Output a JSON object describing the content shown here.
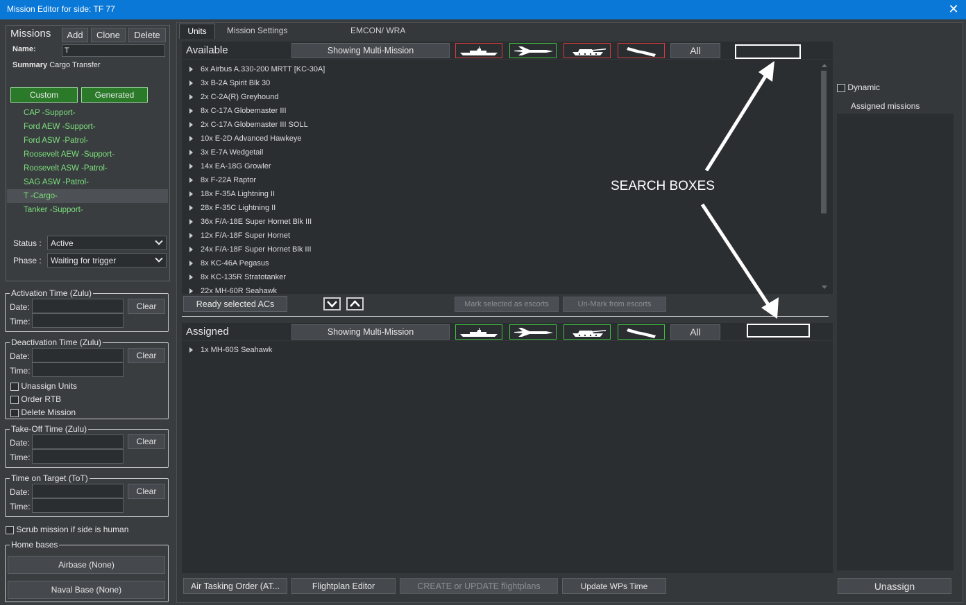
{
  "window": {
    "title": "Mission Editor for side: TF 77",
    "close_symbol": "✕"
  },
  "missions": {
    "header": "Missions",
    "add_label": "Add",
    "clone_label": "Clone",
    "delete_label": "Delete",
    "name_label": "Name:",
    "name_value": "T",
    "summary_label": "Summary",
    "summary_value": "Cargo Transfer",
    "custom_label": "Custom",
    "generated_label": "Generated",
    "items": [
      "CAP -Support-",
      "Ford AEW -Support-",
      "Ford ASW  -Patrol-",
      "Roosevelt AEW -Support-",
      "Roosevelt ASW -Patrol-",
      "SAG ASW  -Patrol-",
      "T -Cargo-",
      "Tanker -Support-"
    ],
    "selected_index": 6,
    "status_label": "Status :",
    "status_value": "Active",
    "phase_label": "Phase :",
    "phase_value": "Waiting for trigger"
  },
  "times": {
    "activation_title": "Activation Time (Zulu)",
    "deactivation_title": "Deactivation Time (Zulu)",
    "takeoff_title": "Take-Off Time (Zulu)",
    "tot_title": "Time on Target (ToT)",
    "date_label": "Date:",
    "time_label": "Time:",
    "clear_label": "Clear",
    "unassign_units": "Unassign Units",
    "order_rtb": "Order RTB",
    "delete_mission": "Delete Mission"
  },
  "scrub_label": "Scrub mission if side is human",
  "home_bases": {
    "title": "Home bases",
    "airbase": "Airbase (None)",
    "naval_base": "Naval Base (None)"
  },
  "tabs": {
    "units": "Units",
    "settings": "Mission Settings",
    "emcon": "EMCON/ WRA"
  },
  "available": {
    "title": "Available",
    "showing": "Showing Multi-Mission",
    "all_label": "All",
    "units": [
      "6x Airbus A.330-200 MRTT [KC-30A]",
      "3x B-2A Spirit Blk 30",
      "2x C-2A(R) Greyhound",
      "8x C-17A Globemaster III",
      "2x C-17A Globemaster III SOLL",
      "10x E-2D Advanced Hawkeye",
      "3x E-7A Wedgetail",
      "14x EA-18G Growler",
      "8x F-22A Raptor",
      "18x F-35A Lightning II",
      "28x F-35C Lightning II",
      "36x F/A-18E Super Hornet Blk III",
      "12x F/A-18F Super Hornet",
      "24x F/A-18F Super Hornet Blk III",
      "8x KC-46A Pegasus",
      "8x KC-135R Stratotanker",
      "22x MH-60R Seahawk"
    ]
  },
  "middle": {
    "ready_label": "Ready selected ACs",
    "mark_label": "Mark selected as escorts",
    "unmark_label": "Un-Mark from escorts"
  },
  "assigned": {
    "title": "Assigned",
    "showing": "Showing Multi-Mission",
    "all_label": "All",
    "units": [
      "1x MH-60S Seahawk"
    ]
  },
  "right_panel": {
    "dynamic_label": "Dynamic",
    "assigned_missions": "Assigned missions",
    "unassign_label": "Unassign"
  },
  "bottom": {
    "ato_label": "Air Tasking Order (AT...",
    "flightplan_label": "Flightplan Editor",
    "create_label": "CREATE or UPDATE flightplans",
    "update_label": "Update WPs Time"
  },
  "annotation": {
    "text": "SEARCH BOXES"
  },
  "colors": {
    "title_bar": "#0a78d7",
    "mission_green": "#7be07b",
    "filter_red": "#d23a3a",
    "filter_green": "#3fbf3f"
  }
}
